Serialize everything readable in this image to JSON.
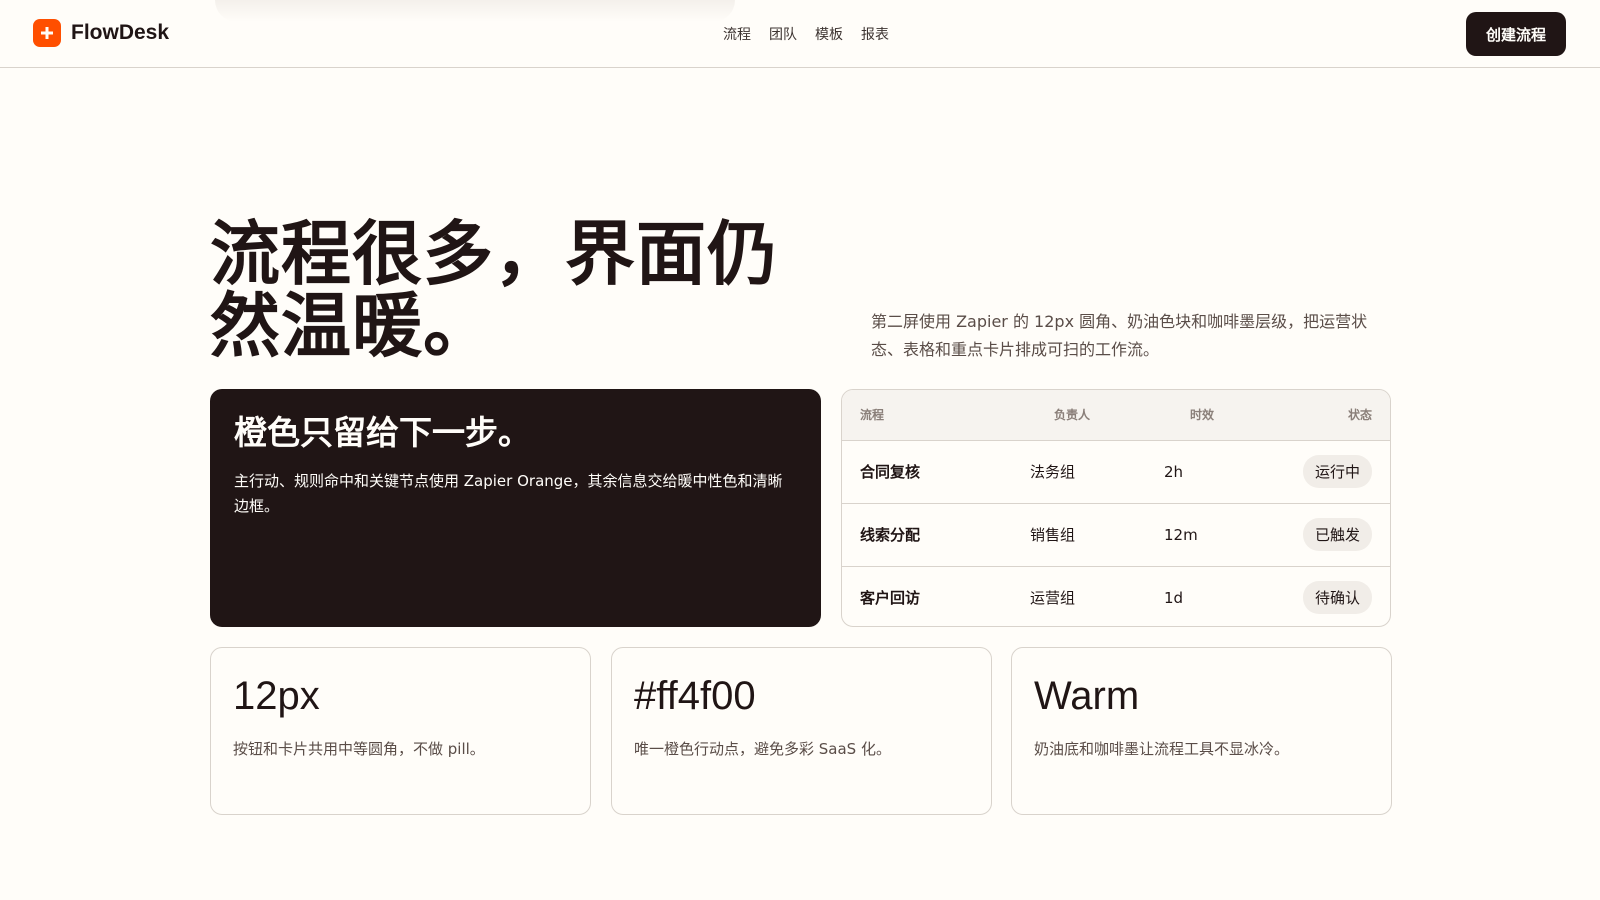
{
  "header": {
    "brand": "FlowDesk",
    "nav": [
      "流程",
      "团队",
      "模板",
      "报表"
    ],
    "cta": "创建流程"
  },
  "hero": {
    "title_line1": "流程很多，界面仍",
    "title_line2": "然温暖。",
    "description": "第二屏使用 Zapier 的 12px 圆角、奶油色块和咖啡墨层级，把运营状态、表格和重点卡片排成可扫的工作流。"
  },
  "feature": {
    "title": "橙色只留给下一步。",
    "body": "主行动、规则命中和关键节点使用 Zapier Orange，其余信息交给暖中性色和清晰边框。"
  },
  "table": {
    "headers": [
      "流程",
      "负责人",
      "时效",
      "状态"
    ],
    "rows": [
      [
        "合同复核",
        "法务组",
        "2h",
        "运行中"
      ],
      [
        "线索分配",
        "销售组",
        "12m",
        "已触发"
      ],
      [
        "客户回访",
        "运营组",
        "1d",
        "待确认"
      ]
    ]
  },
  "stats": [
    {
      "value": "12px",
      "desc": "按钮和卡片共用中等圆角，不做 pill。"
    },
    {
      "value": "#ff4f00",
      "desc": "唯一橙色行动点，避免多彩 SaaS 化。"
    },
    {
      "value": "Warm",
      "desc": "奶油底和咖啡墨让流程工具不显冰冷。"
    }
  ],
  "colors": {
    "accent": "#ff4f00",
    "ink": "#201515",
    "cream": "#fffdf9",
    "border": "#d9d3cc"
  },
  "icons": {
    "brand": "plus-icon"
  }
}
